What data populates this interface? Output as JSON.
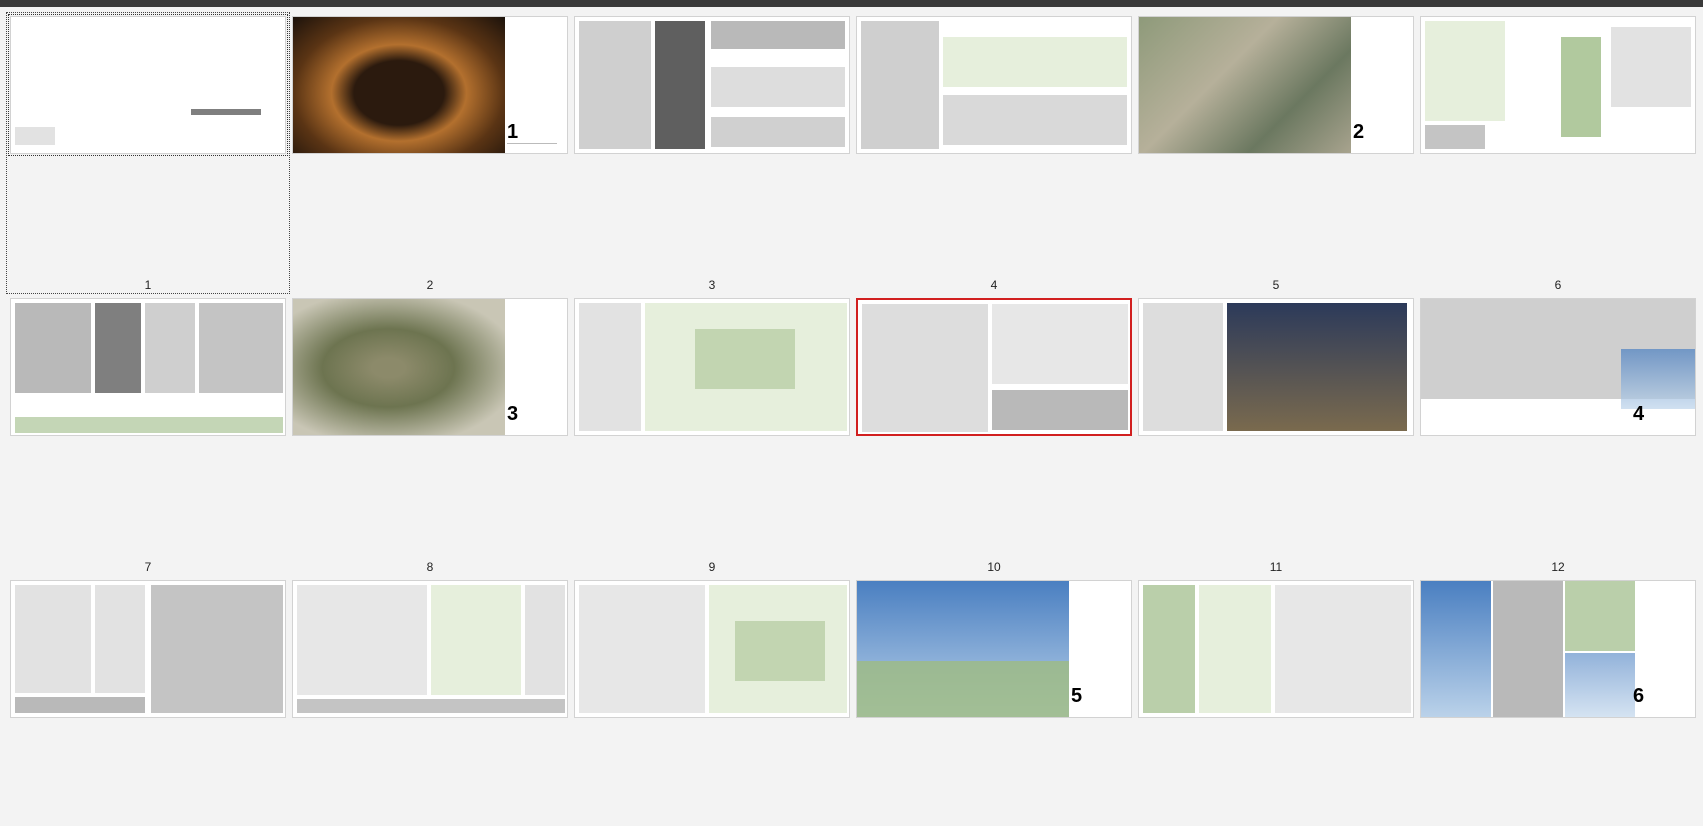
{
  "window": {
    "title": ""
  },
  "colors": {
    "background": "#f3f3f3",
    "selected_border": "#d11f1f"
  },
  "pages": [
    {
      "label": "1",
      "state": "focused"
    },
    {
      "label": "2",
      "state": "normal"
    },
    {
      "label": "3",
      "state": "normal"
    },
    {
      "label": "4",
      "state": "normal"
    },
    {
      "label": "5",
      "state": "normal"
    },
    {
      "label": "6",
      "state": "normal"
    },
    {
      "label": "7",
      "state": "normal"
    },
    {
      "label": "8",
      "state": "normal"
    },
    {
      "label": "9",
      "state": "normal"
    },
    {
      "label": "10",
      "state": "selected"
    },
    {
      "label": "11",
      "state": "normal"
    },
    {
      "label": "12",
      "state": "normal"
    },
    {
      "label": "",
      "state": "normal"
    },
    {
      "label": "",
      "state": "normal"
    },
    {
      "label": "",
      "state": "normal"
    },
    {
      "label": "",
      "state": "normal"
    },
    {
      "label": "",
      "state": "normal"
    },
    {
      "label": "",
      "state": "normal"
    }
  ],
  "thumb_text": {
    "p2_num": "1",
    "p5_num": "2",
    "p8_num": "3",
    "p12_num": "4",
    "p16_num": "5",
    "p18_num": "6"
  }
}
